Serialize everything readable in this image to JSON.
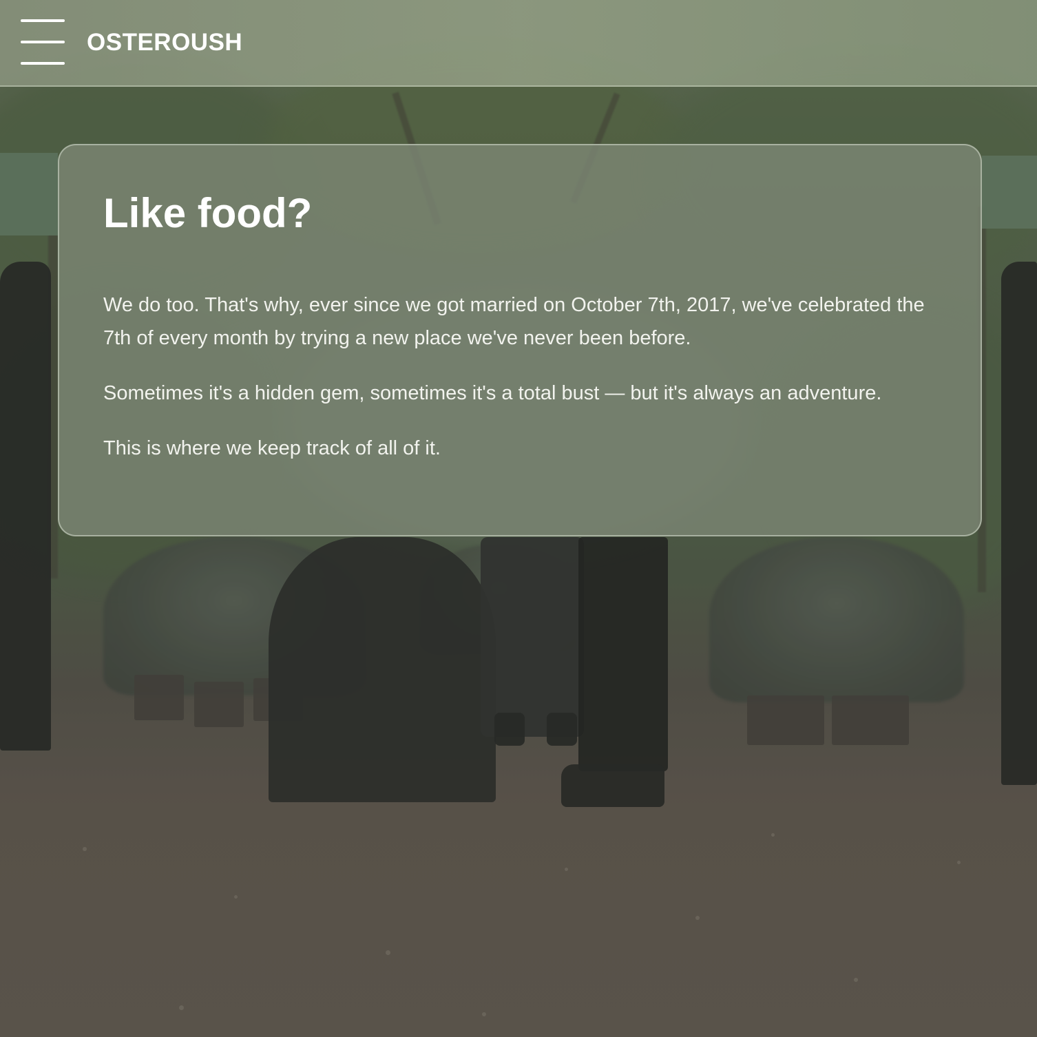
{
  "header": {
    "menu_icon": "hamburger-menu-icon",
    "brand": "OSTEROUSH"
  },
  "intro": {
    "title": "Like food?",
    "paragraphs": [
      "We do too. That's why, ever since we got married on October 7th, 2017, we've celebrated the 7th of every month by trying a new place we've never been before.",
      "Sometimes it's a hidden gem, sometimes it's a total bust — but it's always an adventure.",
      "This is where we keep track of all of it."
    ]
  },
  "colors": {
    "header_overlay": "#929f88",
    "card_overlay": "#7d8876",
    "text": "#ffffff"
  }
}
